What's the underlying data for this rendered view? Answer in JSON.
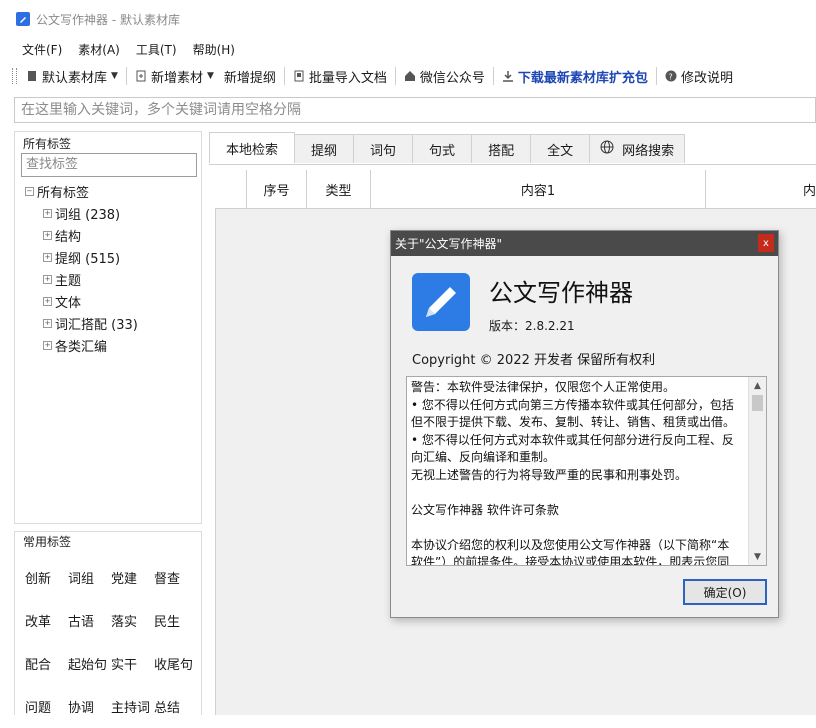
{
  "window": {
    "title": "公文写作神器 - 默认素材库"
  },
  "menu": [
    "文件(F)",
    "素材(A)",
    "工具(T)",
    "帮助(H)"
  ],
  "toolbar": {
    "lib": "默认素材库",
    "add_material": "新增素材",
    "add_outline": "新增提纲",
    "batch_import": "批量导入文档",
    "wechat": "微信公众号",
    "download": "下载最新素材库扩充包",
    "changelog": "修改说明"
  },
  "search": {
    "placeholder": "在这里输入关键词，多个关键词请用空格分隔"
  },
  "tags_panel": {
    "caption": "所有标签",
    "search_placeholder": "查找标签",
    "root": "所有标签",
    "items": [
      "词组 (238)",
      "结构",
      "提纲 (515)",
      "主题",
      "文体",
      "词汇搭配 (33)",
      "各类汇编"
    ]
  },
  "common_tags": {
    "caption": "常用标签",
    "rows": [
      [
        "创新",
        "词组",
        "党建",
        "督查"
      ],
      [
        "改革",
        "古语",
        "落实",
        "民生"
      ],
      [
        "配合",
        "起始句",
        "实干",
        "收尾句"
      ],
      [
        "问题",
        "协调",
        "主持词",
        "总结"
      ]
    ]
  },
  "tabs": [
    "本地检索",
    "提纲",
    "词句",
    "句式",
    "搭配",
    "全文",
    "网络搜索"
  ],
  "grid": {
    "col_seq": "序号",
    "col_type": "类型",
    "col_content1": "内容1",
    "col_content2": "内"
  },
  "dialog": {
    "title": "关于\"公文写作神器\"",
    "close": "x",
    "app_name": "公文写作神器",
    "version": "版本：2.8.2.21",
    "copyright": "Copyright © 2022  开发者 保留所有权利",
    "license_lines": [
      "警告：本软件受法律保护，仅限您个人正常使用。",
      "• 您不得以任何方式向第三方传播本软件或其任何部分，包括但不限于提供下载、发布、复制、转让、销售、租赁或出借。",
      "• 您不得以任何方式对本软件或其任何部分进行反向工程、反向汇编、反向编译和重制。",
      "无视上述警告的行为将导致严重的民事和刑事处罚。",
      "",
      "公文写作神器 软件许可条款",
      "",
      "本协议介绍您的权利以及您使用公文写作神器（以下简称“本软件”）的前提条件。接受本协议或使用本软件，即表示您同"
    ],
    "ok": "确定(O)"
  }
}
